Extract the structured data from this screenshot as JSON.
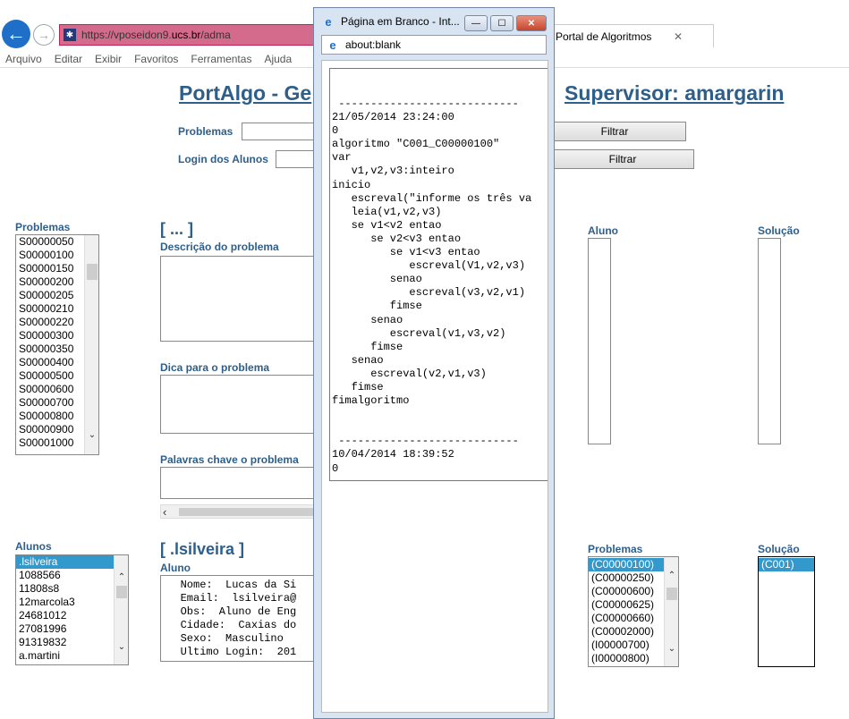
{
  "browser": {
    "url_prefix": "https://vposeidon9.",
    "url_host": "ucs.br",
    "url_path": "/adma",
    "tab_title": "Portal de Algoritmos",
    "tab_close": "✕",
    "menu": [
      "Arquivo",
      "Editar",
      "Exibir",
      "Favoritos",
      "Ferramentas",
      "Ajuda"
    ]
  },
  "page": {
    "title": "PortAlgo - Ge",
    "title_right": "Supervisor: amargarin",
    "filter_problems_label": "Problemas",
    "filter_students_label": "Login dos Alunos",
    "filter_button": "Filtrar",
    "problems_list_label": "Problemas",
    "problems_list": [
      "S00000050",
      "S00000100",
      "S00000150",
      "S00000200",
      "S00000205",
      "S00000210",
      "S00000220",
      "S00000300",
      "S00000350",
      "S00000400",
      "S00000500",
      "S00000600",
      "S00000700",
      "S00000800",
      "S00000900",
      "S00001000"
    ],
    "problem_section_title": "[ ... ]",
    "description_label": "Descrição do problema",
    "hint_label": "Dica para o problema",
    "keywords_label": "Palavras chave o problema",
    "student_col_label": "Aluno",
    "solution_col_label": "Solução",
    "students_list_label": "Alunos",
    "students_list": [
      ".lsilveira",
      "1088566",
      "11808s8",
      "12marcola3",
      "24681012",
      "27081996",
      "91319832",
      "a.martini"
    ],
    "students_selected": ".lsilveira",
    "student_section_title": "[ .lsilveira ]",
    "student_info_label": "Aluno",
    "student_info_lines": [
      "   Nome:  Lucas da Si",
      "   Email:  lsilveira@",
      "   Obs:  Aluno de Eng",
      "   Cidade:  Caxias do",
      "   Sexo:  Masculino",
      "   Ultimo Login:  201"
    ],
    "student_problems_label": "Problemas",
    "student_problems_list": [
      "(C00000100)",
      "(C00000250)",
      "(C00000600)",
      "(C00000625)",
      "(C00000660)",
      "(C00002000)",
      "(I00000700)",
      "(I00000800)"
    ],
    "student_problems_selected": "(C00000100)",
    "student_solution_label": "Solução",
    "student_solution_list": [
      "(C001)"
    ],
    "student_solution_selected": "(C001)"
  },
  "popup": {
    "title": "Página em Branco - Int...",
    "address": "about:blank",
    "content": " ----------------------------\n21/05/2014 23:24:00\n0\nalgoritmo \"C001_C00000100\"\nvar\n   v1,v2,v3:inteiro\ninicio\n   escreval(\"informe os três va\n   leia(v1,v2,v3)\n   se v1<v2 entao\n      se v2<v3 entao\n         se v1<v3 entao\n            escreval(V1,v2,v3)\n         senao\n            escreval(v3,v2,v1)\n         fimse\n      senao\n         escreval(v1,v3,v2)\n      fimse\n   senao\n      escreval(v2,v1,v3)\n   fimse\nfimalgoritmo\n\n\n ----------------------------\n10/04/2014 18:39:52\n0"
  }
}
